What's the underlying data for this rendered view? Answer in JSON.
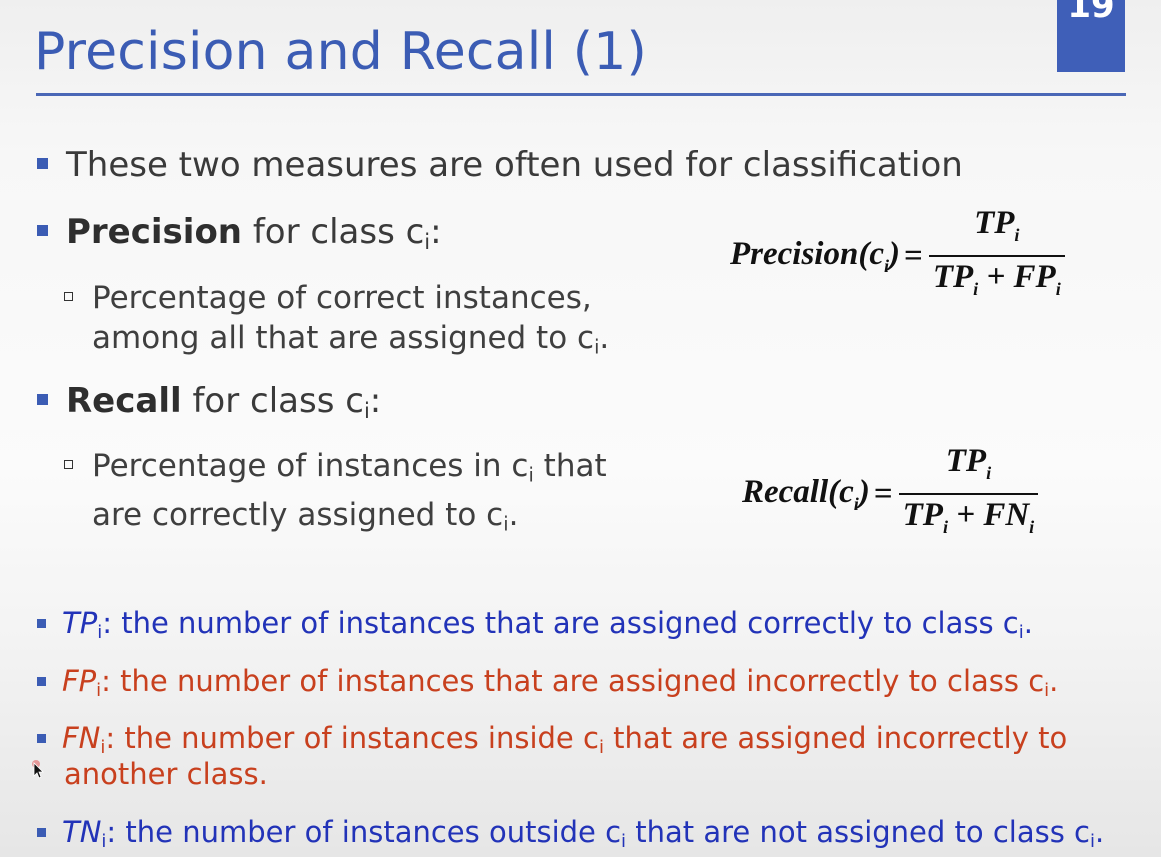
{
  "slide": {
    "number": "19",
    "title": "Precision and Recall (1)"
  },
  "bullets": {
    "intro": "These two measures are often used for classification",
    "precision": {
      "term": "Precision",
      "rest": " for class c",
      "sub": "i",
      "tail": ":",
      "detail_line1": "Percentage of correct instances,",
      "detail_line2_pre": "among all that are assigned to c",
      "detail_line2_sub": "i",
      "detail_line2_tail": "."
    },
    "recall": {
      "term": "Recall",
      "rest": " for class c",
      "sub": "i",
      "tail": ":",
      "detail_line1_pre": "Percentage of instances in c",
      "detail_line1_sub": "i",
      "detail_line1_tail": " that",
      "detail_line2_pre": "are correctly assigned to c",
      "detail_line2_sub": "i",
      "detail_line2_tail": "."
    }
  },
  "formulas": {
    "precision": {
      "lhs": "Precision(c",
      "lhs_sub": "i",
      "lhs_tail": ")",
      "eq": "=",
      "num": "TP",
      "num_sub": "i",
      "den_a": "TP",
      "den_a_sub": "i",
      "den_op": " + ",
      "den_b": "FP",
      "den_b_sub": "i"
    },
    "recall": {
      "lhs": "Recall(c",
      "lhs_sub": "i",
      "lhs_tail": ")",
      "eq": "=",
      "num": "TP",
      "num_sub": "i",
      "den_a": "TP",
      "den_a_sub": "i",
      "den_op": " + ",
      "den_b": "FN",
      "den_b_sub": "i"
    }
  },
  "definitions": {
    "tp": {
      "term": "TP",
      "sub": "i",
      "text_pre": ": the number of instances that are assigned correctly to class c",
      "text_sub": "i",
      "text_tail": "."
    },
    "fp": {
      "term": "FP",
      "sub": "i",
      "text_pre": ": the number of instances that are assigned incorrectly to class c",
      "text_sub": "i",
      "text_tail": "."
    },
    "fn": {
      "term": "FN",
      "sub": "i",
      "text_pre": ": the number of instances inside c",
      "text_sub": "i",
      "text_tail": " that are assigned incorrectly to",
      "line2": "another class."
    },
    "tn": {
      "term": "TN",
      "sub": "i",
      "text_pre": ": the number of instances outside c",
      "text_sub": "i",
      "text_tail": " that are not assigned to class c",
      "text_sub2": "i",
      "text_tail2": "."
    }
  },
  "colors": {
    "accent": "#3b5cb4",
    "definition_blue": "#2233b8",
    "definition_red": "#c8401e"
  },
  "icons": {
    "cursor": "mouse-pointer-icon"
  }
}
